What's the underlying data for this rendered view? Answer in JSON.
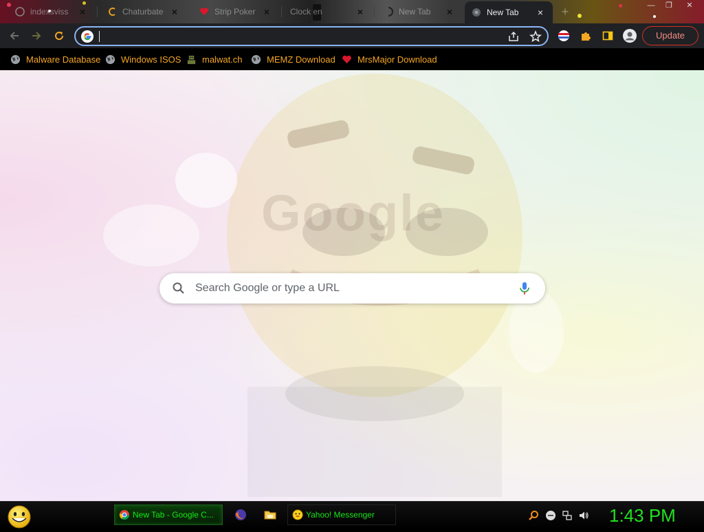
{
  "tabs": [
    {
      "title": "indexsviss",
      "favicon": "globe-icon"
    },
    {
      "title": "Chaturbate",
      "favicon": "chaturbate-icon"
    },
    {
      "title": "Strip Poker",
      "favicon": "heart-icon"
    },
    {
      "title": "Clock en",
      "favicon": "none"
    },
    {
      "title": "New Tab",
      "favicon": "loading-icon"
    },
    {
      "title": "New Tab",
      "favicon": "chrome-icon",
      "active": true
    }
  ],
  "toolbar": {
    "address_value": "",
    "update_label": "Update"
  },
  "bookmarks": [
    {
      "label": "Malware Database",
      "icon": "globe-icon"
    },
    {
      "label": "Windows ISOS",
      "icon": "globe-icon"
    },
    {
      "label": "malwat.ch",
      "icon": "robot-icon"
    },
    {
      "label": "MEMZ Download",
      "icon": "globe-icon"
    },
    {
      "label": "MrsMajor Download",
      "icon": "heart-icon"
    }
  ],
  "ntp": {
    "search_placeholder": "Search Google or type a URL"
  },
  "taskbar": {
    "tasks": [
      {
        "label": "New Tab - Google C...",
        "icon": "chrome-icon",
        "active": true
      },
      {
        "label": "Yahoo! Messenger",
        "icon": "smiley-icon",
        "active": false
      }
    ],
    "clock": "1:43 PM"
  },
  "colors": {
    "accent_blue": "#8ab4f8",
    "bookmark_text": "#f5a623",
    "taskbar_green": "#19e619",
    "update_red": "#d93025"
  }
}
